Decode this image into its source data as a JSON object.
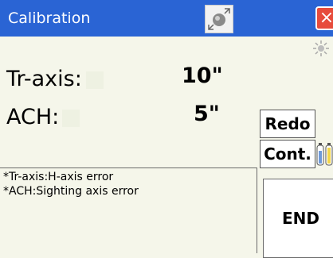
{
  "window": {
    "title": "Calibration",
    "close_glyph": "×",
    "title_icon": "prism-target-icon",
    "status_icon": "sun-icon"
  },
  "readings": [
    {
      "label": "Tr-axis:",
      "value": "10\""
    },
    {
      "label": "ACH:",
      "value": "5\""
    }
  ],
  "buttons": {
    "redo": "Redo",
    "cont": "Cont.",
    "end": "END"
  },
  "info": {
    "line1": "*Tr-axis:H-axis error",
    "line2": "*ACH:Sighting axis error"
  },
  "battery_icon": "battery-icon",
  "colors": {
    "titlebar": "#2a64d4",
    "background": "#f5f6ea",
    "close": "#e74c3c"
  }
}
